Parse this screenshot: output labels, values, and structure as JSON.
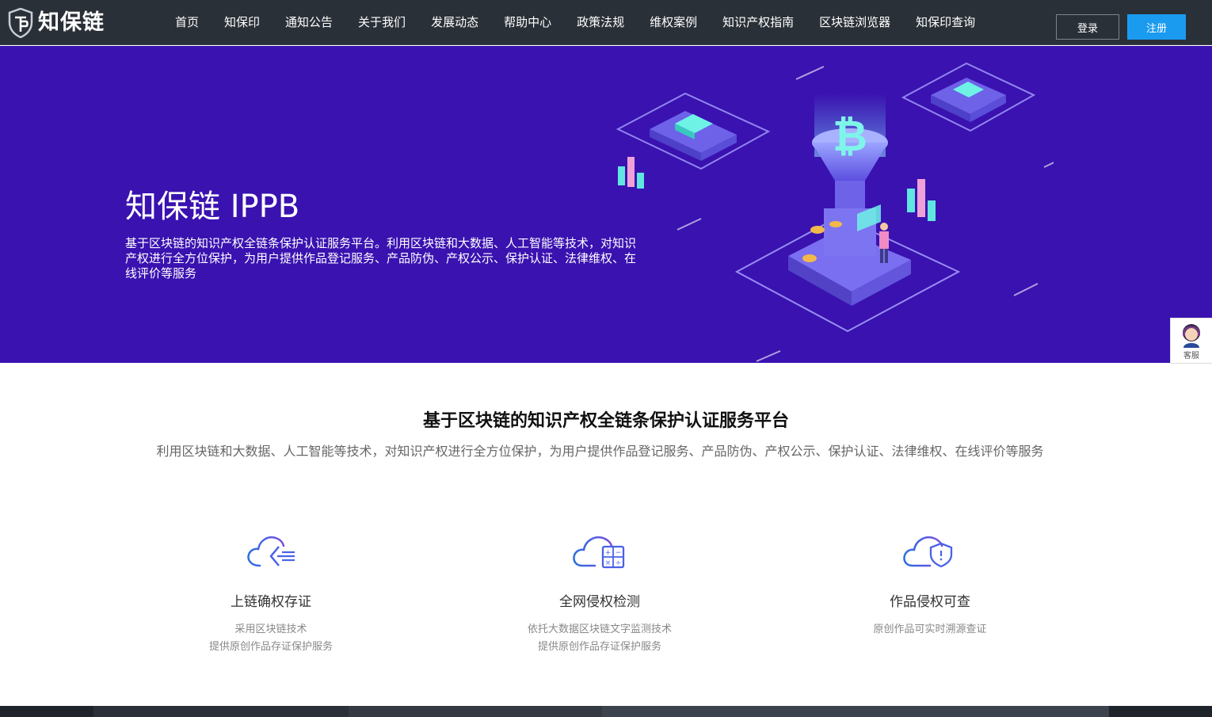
{
  "header": {
    "logo_text": "知保链",
    "nav": [
      "首页",
      "知保印",
      "通知公告",
      "关于我们",
      "发展动态",
      "帮助中心",
      "政策法规",
      "维权案例",
      "知识产权指南",
      "区块链浏览器",
      "知保印查询"
    ],
    "login_label": "登录",
    "register_label": "注册"
  },
  "hero": {
    "title": "知保链 IPPB",
    "description": "基于区块链的知识产权全链条保护认证服务平台。利用区块链和大数据、人工智能等技术，对知识产权进行全方位保护，为用户提供作品登记服务、产品防伪、产权公示、保护认证、法律维权、在线评价等服务"
  },
  "customer_service": {
    "label": "客服"
  },
  "platform": {
    "title": "基于区块链的知识产权全链条保护认证服务平台",
    "description": "利用区块链和大数据、人工智能等技术，对知识产权进行全方位保护，为用户提供作品登记服务、产品防伪、产权公示、保护认证、法律维权、在线评价等服务"
  },
  "features": [
    {
      "icon": "cloud-upload-icon",
      "title": "上链确权存证",
      "lines": [
        "采用区块链技术",
        "提供原创作品存证保护服务"
      ]
    },
    {
      "icon": "cloud-calculator-icon",
      "title": "全网侵权检测",
      "lines": [
        "依托大数据区块链文字监测技术",
        "提供原创作品存证保护服务"
      ]
    },
    {
      "icon": "cloud-shield-icon",
      "title": "作品侵权可查",
      "lines": [
        "原创作品可实时溯源查证"
      ]
    }
  ],
  "colors": {
    "header_bg": "#2a3037",
    "hero_bg": "#3a12b0",
    "accent": "#1a9bf0"
  }
}
